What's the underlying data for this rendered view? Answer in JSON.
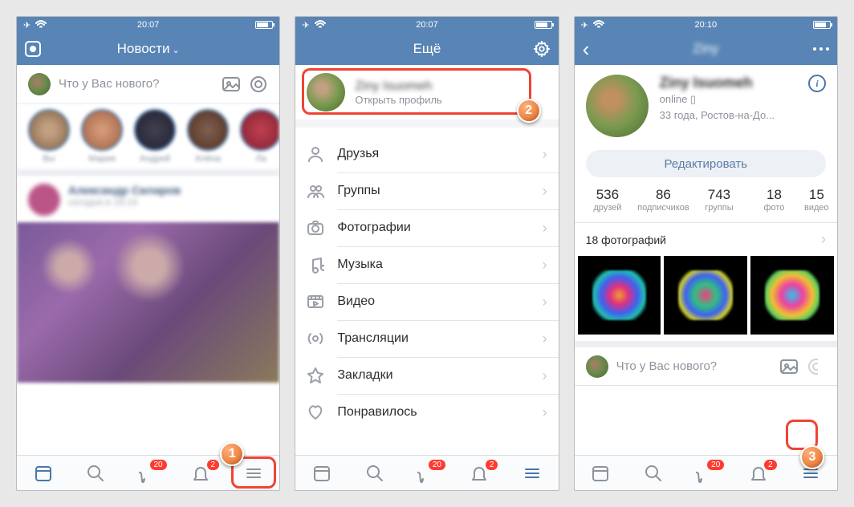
{
  "screen1": {
    "statusbar": {
      "time": "20:07"
    },
    "header": {
      "title": "Новости"
    },
    "compose": {
      "placeholder": "Что у Вас нового?"
    },
    "stories": [
      "Вы",
      "Мария",
      "Андрей",
      "Алёна",
      "Ла"
    ],
    "post": {
      "author": "Александр Силаров",
      "time": "сегодня в 19:14"
    },
    "tabbar": {
      "chat_badge": "20",
      "bell_badge": "2"
    },
    "annot": "1"
  },
  "screen2": {
    "statusbar": {
      "time": "20:07"
    },
    "header": {
      "title": "Ещё"
    },
    "profile": {
      "name": "Ziny Isuomeh",
      "sub": "Открыть профиль"
    },
    "menu": [
      {
        "icon": "friends",
        "label": "Друзья"
      },
      {
        "icon": "groups",
        "label": "Группы"
      },
      {
        "icon": "photos",
        "label": "Фотографии"
      },
      {
        "icon": "music",
        "label": "Музыка"
      },
      {
        "icon": "video",
        "label": "Видео"
      },
      {
        "icon": "live",
        "label": "Трансляции"
      },
      {
        "icon": "bookmarks",
        "label": "Закладки"
      },
      {
        "icon": "liked",
        "label": "Понравилось"
      }
    ],
    "tabbar": {
      "chat_badge": "20",
      "bell_badge": "2"
    },
    "annot": "2"
  },
  "screen3": {
    "statusbar": {
      "time": "20:10"
    },
    "header": {
      "title": "Ziny"
    },
    "profile": {
      "name": "Ziny Isuomeh",
      "status": "online",
      "detail": "33 года, Ростов-на-До..."
    },
    "edit": "Редактировать",
    "stats": [
      {
        "n": "536",
        "l": "друзей"
      },
      {
        "n": "86",
        "l": "подписчиков"
      },
      {
        "n": "743",
        "l": "группы"
      },
      {
        "n": "18",
        "l": "фото"
      },
      {
        "n": "15",
        "l": "видео"
      }
    ],
    "photos_header": "18 фотографий",
    "compose": {
      "placeholder": "Что у Вас нового?"
    },
    "tabbar": {
      "chat_badge": "20",
      "bell_badge": "2"
    },
    "annot": "3"
  }
}
